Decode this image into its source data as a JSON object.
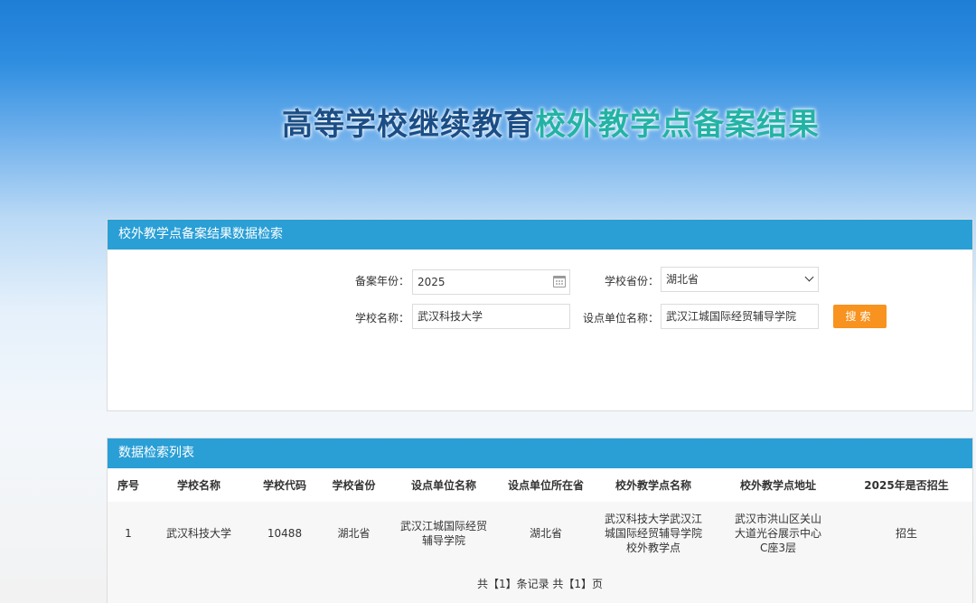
{
  "hero": {
    "title_dark": "高等学校继续教育",
    "title_green": "校外教学点备案结果"
  },
  "search": {
    "header": "校外教学点备案结果数据检索",
    "year_label": "备案年份：",
    "year_value": "2025",
    "province_label": "学校省份：",
    "province_value": "湖北省",
    "school_label": "学校名称：",
    "school_value": "武汉科技大学",
    "unit_label": "设点单位名称：",
    "unit_value": "武汉江城国际经贸辅导学院",
    "search_button": "搜索"
  },
  "results": {
    "header": "数据检索列表",
    "columns": [
      "序号",
      "学校名称",
      "学校代码",
      "学校省份",
      "设点单位名称",
      "设点单位所在省",
      "校外教学点名称",
      "校外教学点地址",
      "2025年是否招生"
    ],
    "rows": [
      {
        "index": "1",
        "school": "武汉科技大学",
        "code": "10488",
        "province": "湖北省",
        "unit": "武汉江城国际经贸辅导学院",
        "unit_province": "湖北省",
        "site_name": "武汉科技大学武汉江城国际经贸辅导学院校外教学点",
        "site_address": "武汉市洪山区关山大道光谷展示中心C座3层",
        "enrolling": "招生"
      }
    ],
    "pager": "共【1】条记录 共【1】页"
  },
  "colors": {
    "header_bar": "#2a9fd6",
    "search_button": "#f7931e",
    "title_dark": "#1b4e86",
    "title_green": "#23b3a5"
  }
}
